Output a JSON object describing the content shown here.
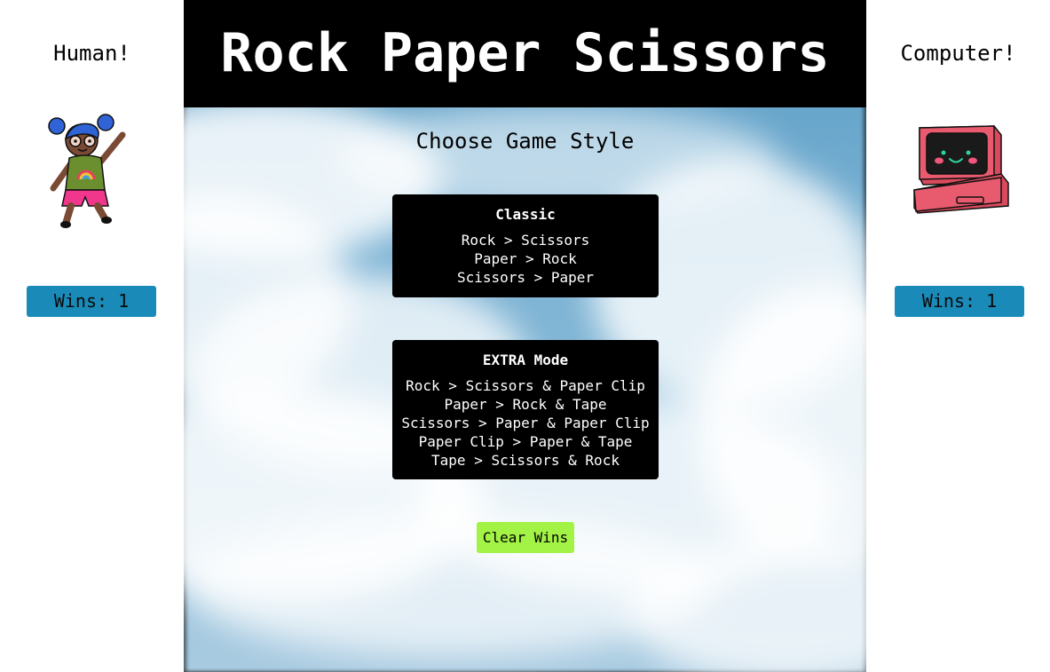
{
  "human": {
    "name": "Human!",
    "wins_label": "Wins: 1",
    "icon": "girl-avatar-icon"
  },
  "computer": {
    "name": "Computer!",
    "wins_label": "Wins: 1",
    "icon": "computer-avatar-icon"
  },
  "header": {
    "title": "Rock Paper Scissors"
  },
  "main": {
    "subtitle": "Choose Game Style",
    "modes": [
      {
        "title": "Classic",
        "rules": [
          "Rock > Scissors",
          "Paper > Rock",
          "Scissors > Paper"
        ]
      },
      {
        "title": "EXTRA Mode",
        "rules": [
          "Rock > Scissors & Paper Clip",
          "Paper > Rock & Tape",
          "Scissors > Paper & Paper Clip",
          "Paper Clip > Paper & Tape",
          "Tape > Scissors & Rock"
        ]
      }
    ],
    "clear_label": "Clear Wins"
  },
  "colors": {
    "wins_badge": "#1a8ab8",
    "clear_button": "#a3f246",
    "sky": "#79b1d3",
    "title_bar": "#000000"
  }
}
